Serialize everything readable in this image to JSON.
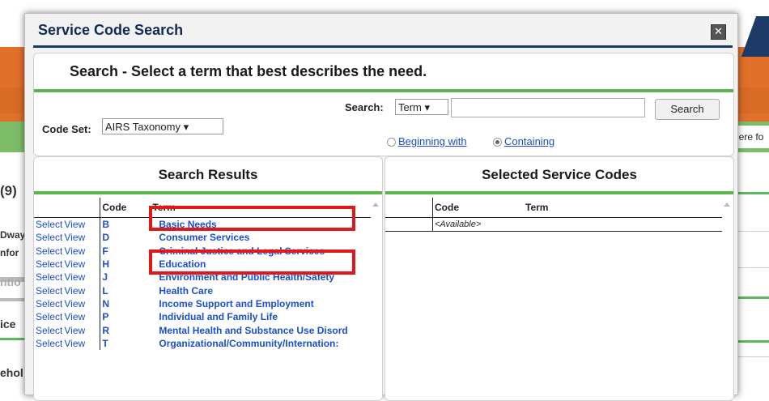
{
  "dialog": {
    "title": "Service Code Search",
    "close_icon": "close-icon"
  },
  "search": {
    "heading": "Search - Select a term that best describes the need.",
    "code_set_label": "Code Set:",
    "code_set_value": "AIRS Taxonomy ▾",
    "search_label": "Search:",
    "search_type_value": "Term ▾",
    "search_value": "",
    "search_button": "Search",
    "radio_beginning": "Beginning with",
    "radio_containing": "Containing"
  },
  "results": {
    "heading": "Search Results",
    "col_code": "Code",
    "col_term": "Term",
    "select_label": "Select",
    "view_label": "View",
    "rows": [
      {
        "code": "B",
        "term": "Basic Needs"
      },
      {
        "code": "D",
        "term": "Consumer Services"
      },
      {
        "code": "F",
        "term": "Criminal Justice and Legal Services"
      },
      {
        "code": "H",
        "term": "Education"
      },
      {
        "code": "J",
        "term": "Environment and Public Health/Safety"
      },
      {
        "code": "L",
        "term": "Health Care"
      },
      {
        "code": "N",
        "term": "Income Support and Employment"
      },
      {
        "code": "P",
        "term": "Individual and Family Life"
      },
      {
        "code": "R",
        "term": "Mental Health and Substance Use Disord"
      },
      {
        "code": "T",
        "term": "Organizational/Community/Internation:"
      }
    ]
  },
  "selected": {
    "heading": "Selected Service Codes",
    "col_code": "Code",
    "col_term": "Term",
    "empty_text": "<Available>"
  },
  "background": {
    "right_snippet": "here fo",
    "left_snippets": [
      "(9)",
      "Dway",
      "nfor",
      "ntio",
      "ice",
      "ehol"
    ]
  }
}
